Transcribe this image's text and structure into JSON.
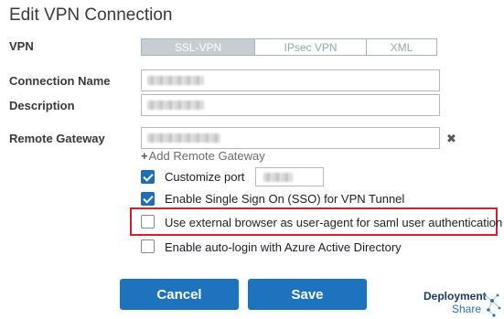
{
  "title": "Edit VPN Connection",
  "labels": {
    "vpn": "VPN",
    "connection_name": "Connection Name",
    "description": "Description",
    "remote_gateway": "Remote Gateway"
  },
  "vpn_type": {
    "options": [
      "SSL-VPN",
      "IPsec VPN",
      "XML"
    ],
    "selected": "SSL-VPN"
  },
  "fields": {
    "connection_name_value": "[redacted]",
    "description_value": "[redacted]",
    "remote_gateway_value": "[redacted]",
    "port_value": "[redacted]"
  },
  "add_gateway": {
    "icon": "plus-icon",
    "label": "Add Remote Gateway"
  },
  "options": {
    "customize_port": {
      "label": "Customize port",
      "checked": true
    },
    "sso": {
      "label": "Enable Single Sign On (SSO) for VPN Tunnel",
      "checked": true
    },
    "external_browser": {
      "label": "Use external browser as user-agent for saml user authentication",
      "checked": false
    },
    "auto_login": {
      "label": "Enable auto-login with Azure Active Directory",
      "checked": false
    }
  },
  "buttons": {
    "cancel": "Cancel",
    "save": "Save"
  },
  "watermark": {
    "line1": "Deployment",
    "line2": "Share"
  },
  "colors": {
    "primary": "#1e73be",
    "highlight": "#d9202a",
    "segment_active": "#c8cdd2"
  }
}
